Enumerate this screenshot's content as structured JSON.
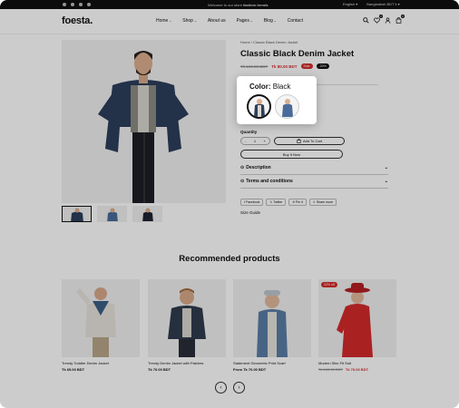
{
  "topbar": {
    "message_prefix": "Welcome to our store",
    "message_bold": "fashion trends",
    "language": "English ▾",
    "currency": "Bangladesh BDT ৳ ▾"
  },
  "header": {
    "logo": "foesta.",
    "nav": [
      {
        "label": "Home",
        "has_dropdown": true
      },
      {
        "label": "Shop",
        "has_dropdown": true
      },
      {
        "label": "About us",
        "has_dropdown": false
      },
      {
        "label": "Pages",
        "has_dropdown": true
      },
      {
        "label": "Blog",
        "has_dropdown": true
      },
      {
        "label": "Contact",
        "has_dropdown": false
      }
    ],
    "wishlist_count": "0",
    "cart_count": "0"
  },
  "product": {
    "breadcrumb_home": "Home",
    "breadcrumb_sep": "/",
    "breadcrumb_current": "Classic Black Denim Jacket",
    "title": "Classic Black Denim Jacket",
    "old_price": "Tk 100.00 BDT",
    "new_price": "Tk 80.00 BDT",
    "sale_label": "Sale",
    "discount_label": "-20%",
    "quantity_label": "Quantity",
    "quantity_value": "1",
    "minus": "-",
    "plus": "+",
    "add_to_cart": "Add To Cart",
    "buy_now": "Buy It Now",
    "accordion": [
      {
        "label": "Description"
      },
      {
        "label": "Terms and conditions"
      }
    ],
    "share": [
      "Facebook",
      "Twitter",
      "Pin it",
      "Share more"
    ],
    "size_guide": "Size Guide"
  },
  "color_popup": {
    "label": "Color:",
    "value": "Black"
  },
  "recommended": {
    "title": "Recommended products",
    "items": [
      {
        "name": "Trendy Toddler Denim Jacket",
        "price": "Tk 65.00 BDT",
        "old_price": "",
        "sale": ""
      },
      {
        "name": "Trendy Denim Jacket with Patches",
        "price": "Tk 70.00 BDT",
        "old_price": "",
        "sale": ""
      },
      {
        "name": "Statement Geometric Print Scarf",
        "price": "From Tk 70.00 BDT",
        "old_price": "",
        "sale": ""
      },
      {
        "name": "Modern Slim Fit Suit",
        "price": "Tk 70.00 BDT",
        "old_price": "Tk 100.00 BDT",
        "sale": "22% off"
      }
    ],
    "prev": "‹",
    "next": "›"
  },
  "colors": {
    "accent_red": "#d62b2b",
    "dark": "#111111",
    "denim": "#2c3e5c"
  }
}
